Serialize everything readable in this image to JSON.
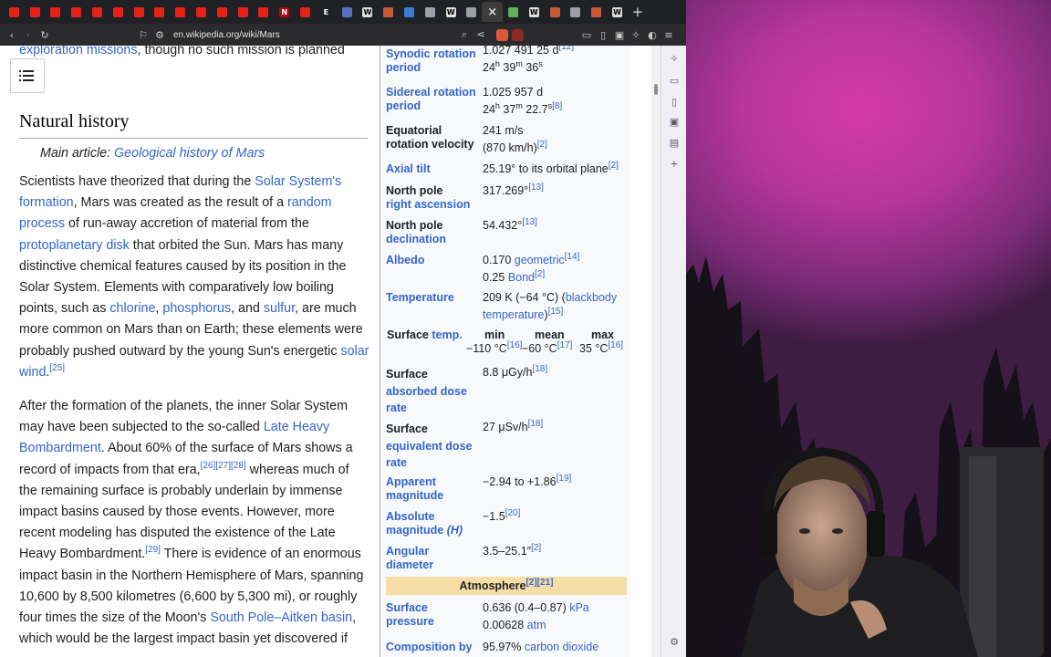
{
  "browser": {
    "url": "en.wikipedia.org/wiki/Mars",
    "tabs": [
      {
        "icon": "youtube-icon",
        "color": "#e62117",
        "glyph": ""
      },
      {
        "icon": "youtube-icon",
        "color": "#e62117",
        "glyph": ""
      },
      {
        "icon": "youtube-icon",
        "color": "#e62117",
        "glyph": ""
      },
      {
        "icon": "youtube-icon",
        "color": "#e62117",
        "glyph": ""
      },
      {
        "icon": "youtube-icon",
        "color": "#e62117",
        "glyph": ""
      },
      {
        "icon": "youtube-icon",
        "color": "#e62117",
        "glyph": ""
      },
      {
        "icon": "youtube-icon",
        "color": "#e62117",
        "glyph": ""
      },
      {
        "icon": "youtube-icon",
        "color": "#e62117",
        "glyph": ""
      },
      {
        "icon": "youtube-icon",
        "color": "#e62117",
        "glyph": ""
      },
      {
        "icon": "youtube-icon",
        "color": "#e62117",
        "glyph": ""
      },
      {
        "icon": "youtube-icon",
        "color": "#e62117",
        "glyph": ""
      },
      {
        "icon": "youtube-icon",
        "color": "#e62117",
        "glyph": ""
      },
      {
        "icon": "youtube-icon",
        "color": "#e62117",
        "glyph": ""
      },
      {
        "icon": "netflix-icon",
        "color": "#b20710",
        "glyph": "N"
      },
      {
        "icon": "youtube-icon",
        "color": "#e62117",
        "glyph": ""
      },
      {
        "icon": "engadget-icon",
        "color": "#202124",
        "glyph": "E"
      },
      {
        "icon": "globe-icon",
        "color": "#5a6ec2",
        "glyph": ""
      },
      {
        "icon": "wikipedia-icon",
        "color": "#dddddd",
        "glyph": "W"
      },
      {
        "icon": "site-icon",
        "color": "#c75b39",
        "glyph": ""
      },
      {
        "icon": "site-icon",
        "color": "#3a7bd5",
        "glyph": ""
      },
      {
        "icon": "site-icon",
        "color": "#9aa0a6",
        "glyph": ""
      },
      {
        "icon": "wikipedia-icon",
        "color": "#dddddd",
        "glyph": "W"
      },
      {
        "icon": "site-icon",
        "color": "#9aa0a6",
        "glyph": ""
      },
      {
        "icon": "close-icon",
        "color": "#3c3c3c",
        "glyph": "×",
        "active": true
      },
      {
        "icon": "site-icon",
        "color": "#60b060",
        "glyph": ""
      },
      {
        "icon": "wikipedia-icon",
        "color": "#dddddd",
        "glyph": "W"
      },
      {
        "icon": "site-icon",
        "color": "#c75b39",
        "glyph": ""
      },
      {
        "icon": "site-icon",
        "color": "#9aa0a6",
        "glyph": ""
      },
      {
        "icon": "site-icon",
        "color": "#c75b39",
        "glyph": ""
      },
      {
        "icon": "wikipedia-icon",
        "color": "#dddddd",
        "glyph": "W"
      }
    ]
  },
  "article": {
    "top_line_link": "exploration missions",
    "top_line_text": ", though no such mission is planned",
    "heading": "Natural history",
    "hatnote_prefix": "Main article: ",
    "hatnote_link": "Geological history of Mars",
    "para1": [
      {
        "t": "Scientists have theorized that during the "
      },
      {
        "l": "Solar System's formation"
      },
      {
        "t": ", Mars was created as the result of a "
      },
      {
        "l": "random process"
      },
      {
        "t": " of run-away accretion of material from the "
      },
      {
        "l": "protoplanetary disk"
      },
      {
        "t": " that orbited the Sun. Mars has many distinctive chemical features caused by its position in the Solar System. Elements with comparatively low boiling points, such as "
      },
      {
        "l": "chlorine"
      },
      {
        "t": ", "
      },
      {
        "l": "phosphorus"
      },
      {
        "t": ", and "
      },
      {
        "l": "sulfur"
      },
      {
        "t": ", are much more common on Mars than on Earth; these elements were probably pushed outward by the young Sun's energetic "
      },
      {
        "l": "solar wind"
      },
      {
        "t": "."
      },
      {
        "s": "[25]"
      }
    ],
    "para2": [
      {
        "t": "After the formation of the planets, the inner Solar System may have been subjected to the so-called "
      },
      {
        "l": "Late Heavy Bombardment"
      },
      {
        "t": ". About 60% of the surface of Mars shows a record of impacts from that era,"
      },
      {
        "s": "[26][27][28]"
      },
      {
        "t": " whereas much of the remaining surface is probably underlain by immense impact basins caused by those events. However, more recent modeling has disputed the existence of the Late Heavy Bombardment."
      },
      {
        "s": "[29]"
      },
      {
        "t": " There is evidence of an enormous impact basin in the Northern Hemisphere of Mars, spanning 10,600 by 8,500 kilometres (6,600 by 5,300 mi), or roughly four times the size of the Moon's "
      },
      {
        "l": "South Pole–Aitken basin"
      },
      {
        "t": ", which would be the largest impact basin yet discovered if"
      }
    ]
  },
  "infobox": {
    "rows": [
      {
        "label_link": "Synodic rotation period",
        "value": "1.027 491 25 d",
        "sup": "[12]",
        "value2": "24",
        "v2parts": [
          "24",
          "h",
          " 39",
          "m",
          " 36",
          "s"
        ]
      },
      {
        "label_link": "Sidereal rotation period",
        "value": "1.025 957 d",
        "v2parts": [
          "24",
          "h",
          " 37",
          "m",
          " 22.7",
          "s"
        ],
        "sup2": "[8]"
      },
      {
        "label": "Equatorial rotation velocity",
        "value": "241 m/s",
        "value2": "(870 km/h)",
        "sup2": "[2]"
      },
      {
        "label_link": "Axial tilt",
        "value": "25.19° to its orbital plane",
        "sup": "[2]"
      },
      {
        "label": "North pole",
        "label_link2": "right ascension",
        "value": "317.269°",
        "sup": "[13]"
      },
      {
        "label": "North pole",
        "label_link2": "declination",
        "value": "54.432°",
        "sup": "[13]"
      },
      {
        "label_link": "Albedo",
        "value": "0.170 ",
        "vlink": "geometric",
        "sup": "[14]",
        "value2": "0.25 ",
        "v2link": "Bond",
        "sup2": "[2]"
      },
      {
        "label_link": "Temperature",
        "value": "209 K (−64 °C) (",
        "vlink": "blackbody temperature",
        "value_end": ")",
        "sup": "[15]"
      },
      {
        "label": "Surface",
        "label_link2": "absorbed dose rate",
        "value": "8.8 μGy/h",
        "sup": "[18]"
      },
      {
        "label": "Surface",
        "label_link2": "equivalent dose rate",
        "value": "27 μSv/h",
        "sup": "[18]"
      },
      {
        "label_link": "Apparent magnitude",
        "value": "−2.94 to +1.86",
        "sup": "[19]"
      },
      {
        "label_link": "Absolute magnitude",
        "label_italic": "(H)",
        "value": "−1.5",
        "sup": "[20]"
      },
      {
        "label_link": "Angular diameter",
        "value": "3.5–25.1″",
        "sup": "[2]"
      }
    ],
    "temp": {
      "label": "Surface",
      "label_link": "temp.",
      "cols": [
        "min",
        "mean",
        "max"
      ],
      "values": [
        "−110 °C",
        "−60 °C",
        "35 °C"
      ],
      "sups": [
        "[16]",
        "[17]",
        "[16]"
      ]
    },
    "atmosphere_header": "Atmosphere",
    "atmosphere_sup": "[2][21]",
    "pressure": {
      "label_link": "Surface pressure",
      "value": "0.636 (0.4–0.87) ",
      "vlink": "kPa",
      "value2": "0.00628 ",
      "v2link": "atm"
    },
    "composition": {
      "label_link": "Composition by",
      "value": "95.97% ",
      "vlink": "carbon dioxide"
    }
  },
  "colors": {
    "link": "#3366cc",
    "atmosphere_header": "#f5dfa7",
    "webcam_sky": "#c23a9f"
  }
}
